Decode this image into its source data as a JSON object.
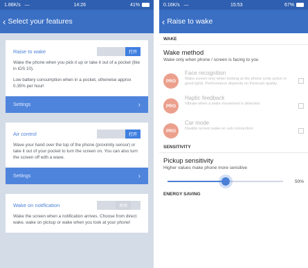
{
  "left": {
    "status": {
      "left": "1.86K/s  —",
      "time": "14:26",
      "right": "41%"
    },
    "appbar": {
      "back": "‹",
      "title": "Select your features"
    },
    "cards": [
      {
        "title": "Raise to wake",
        "toggle_text": "打开",
        "toggle_on": true,
        "paragraphs": [
          "Wake the phone when you pick it up or take it out of a pocket (like in iOS 10).",
          "Low battery consumption when in a pocket, otherwise approx 0.35% per hour!"
        ],
        "settings_label": "Settings"
      },
      {
        "title": "Air control",
        "toggle_text": "打开",
        "toggle_on": true,
        "paragraphs": [
          "Wave your hand over the top of the phone (proximity sensor) or take it out of your pocket to turn the screen on. You can also turn the screen off with a wave."
        ],
        "settings_label": "Settings"
      },
      {
        "title": "Wake on notification",
        "toggle_text": "关闭",
        "toggle_on": false,
        "paragraphs": [
          "Wake the screen when a notification arrives. Choose from direct wake, wake on pickup or wake when you look at your phone!"
        ]
      }
    ]
  },
  "right": {
    "status": {
      "left": "0.16K/s  —",
      "time": "15:53",
      "right": "67%"
    },
    "appbar": {
      "back": "‹",
      "title": "Raise to wake"
    },
    "sections": {
      "wake": "WAKE",
      "sensitivity": "SENSITIVITY",
      "energy": "ENERGY SAVING"
    },
    "wake_method": {
      "title": "Wake method",
      "subtitle": "Wake only when phone / screen is facing to you"
    },
    "pro_badge": "PRO",
    "pro_items": [
      {
        "title": "Face recognition",
        "subtitle": "Wake screen only when looking at the phone (only active in good light). Performance depends on frontcam quality.",
        "checked": false
      },
      {
        "title": "Haptic feedback",
        "subtitle": "Vibrate when a wake movement is detected",
        "checked": false
      },
      {
        "title": "Car mode",
        "subtitle": "Disable screen wake on usb connection",
        "checked": false
      }
    ],
    "pickup": {
      "title": "Pickup sensitivity",
      "subtitle": "Higher values make phone more sensitive",
      "value_label": "50%",
      "value": 0.5
    }
  },
  "colors": {
    "primary": "#3a6fc4",
    "statusbar": "#2f5fb0",
    "accent": "#4a7fd6",
    "pro": "#d9431e"
  }
}
